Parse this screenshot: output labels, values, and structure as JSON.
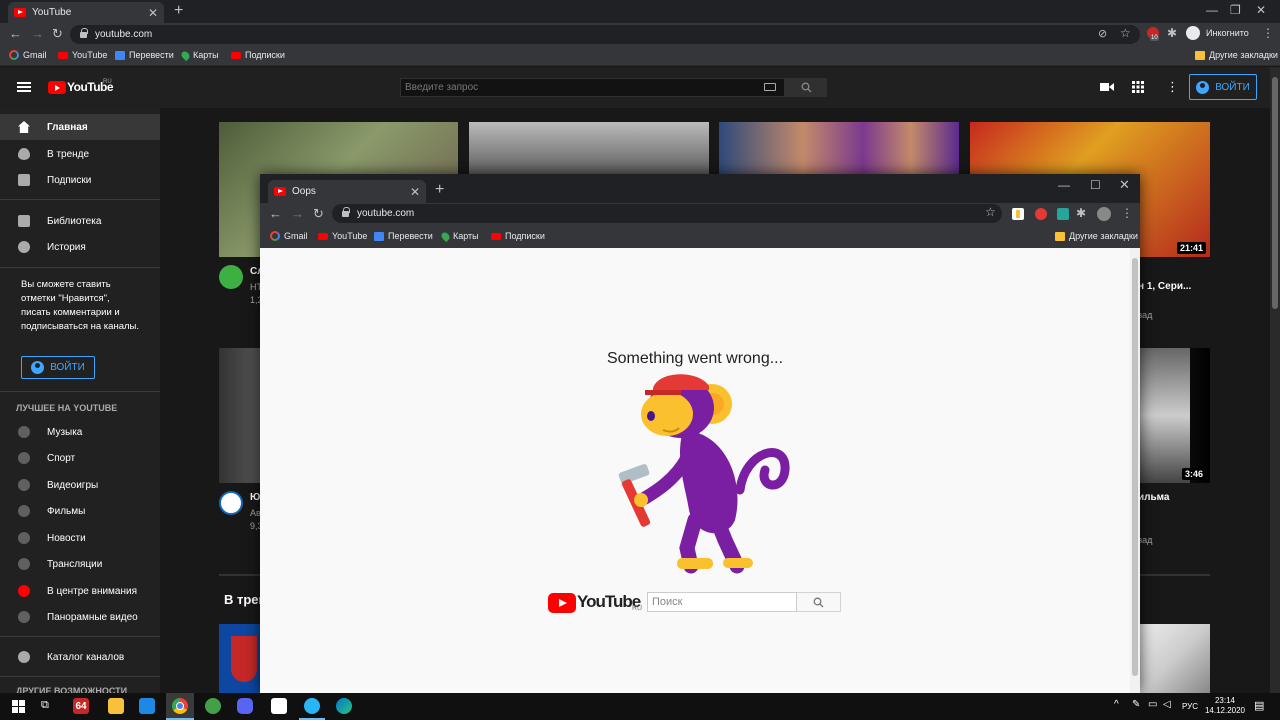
{
  "outer_browser": {
    "tab_title": "YouTube",
    "url": "youtube.com",
    "profile_label": "Инкогнито",
    "ext_badge": "10",
    "bookmarks": [
      "Gmail",
      "YouTube",
      "Перевести",
      "Карты",
      "Подписки"
    ],
    "other_bookmarks": "Другие закладки"
  },
  "youtube": {
    "region": "RU",
    "search_placeholder": "Введите запрос",
    "signin_label": "ВОЙТИ",
    "sidebar": {
      "primary": [
        "Главная",
        "В тренде",
        "Подписки"
      ],
      "library": [
        "Библиотека",
        "История"
      ],
      "promo_text": "Вы сможете ставить отметки \"Нравится\", писать комментарии и подписываться на каналы.",
      "signin_label": "ВОЙТИ",
      "best_heading": "ЛУЧШЕЕ НА YOUTUBE",
      "best": [
        "Музыка",
        "Спорт",
        "Видеоигры",
        "Фильмы",
        "Новости",
        "Трансляции",
        "В центре внимания",
        "Панорамные видео"
      ],
      "catalog": "Каталог каналов",
      "more_heading": "ДРУГИЕ ВОЗМОЖНОСТИ"
    },
    "videos": {
      "v1_title_part": "Сл",
      "v1_meta1": "НТ",
      "v1_meta2": "1,2",
      "v4_duration": "21:41",
      "v4_title_part": "н 1, Сери...",
      "v4_meta": "зад",
      "v5_title_part": "Ю",
      "v5_meta1": "Ав",
      "v5_meta2": "9,3",
      "v8_duration": "3:46",
      "v8_title_part": "ильма",
      "v8_meta": "зад",
      "trending_heading_part": "В трен"
    }
  },
  "inner_browser": {
    "tab_title": "Oops",
    "url": "youtube.com",
    "bookmarks": [
      "Gmail",
      "YouTube",
      "Перевести",
      "Карты",
      "Подписки"
    ],
    "other_bookmarks": "Другие закладки",
    "error_message": "Something went wrong...",
    "logo_text": "YouTube",
    "logo_region": "RU",
    "search_placeholder": "Поиск"
  },
  "taskbar": {
    "badge_64": "64",
    "language": "РУС",
    "time": "23:14",
    "date": "14.12.2020"
  },
  "colors": {
    "yt_red": "#ff0000",
    "signin_blue": "#3ea6ff",
    "monkey_purple": "#7b1fa2",
    "monkey_yellow": "#fbc02d",
    "hat_red": "#e53935"
  }
}
